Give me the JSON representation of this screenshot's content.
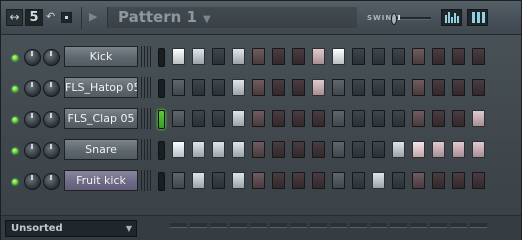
{
  "titlebar": {
    "channel_number": "5",
    "pattern_name": "Pattern 1",
    "swing_label": "SWING",
    "icons": [
      "arrows-icon",
      "undo-icon",
      "menu-icon",
      "play-arrow-icon",
      "dropdown-icon",
      "graph-view-icon",
      "keyboard-view-icon"
    ]
  },
  "swing_level": 0,
  "channels": [
    {
      "name": "Kick",
      "selected": false,
      "active_selector": false
    },
    {
      "name": "FLS_Hatop 05",
      "selected": false,
      "active_selector": false
    },
    {
      "name": "FLS_Clap 05",
      "selected": false,
      "active_selector": true
    },
    {
      "name": "Snare",
      "selected": false,
      "active_selector": false
    },
    {
      "name": "Fruit kick",
      "selected": true,
      "active_selector": false
    }
  ],
  "steps": [
    [
      1,
      1,
      0,
      1,
      0,
      0,
      0,
      1,
      1,
      0,
      0,
      0,
      0,
      0,
      0,
      0
    ],
    [
      0,
      0,
      0,
      1,
      0,
      0,
      0,
      1,
      0,
      0,
      0,
      0,
      0,
      0,
      0,
      0
    ],
    [
      0,
      0,
      0,
      1,
      0,
      0,
      0,
      0,
      0,
      0,
      0,
      0,
      0,
      0,
      0,
      1
    ],
    [
      1,
      1,
      1,
      1,
      0,
      0,
      0,
      0,
      0,
      0,
      0,
      1,
      1,
      1,
      1,
      1
    ],
    [
      0,
      1,
      0,
      1,
      0,
      0,
      0,
      0,
      0,
      0,
      1,
      0,
      0,
      0,
      0,
      0
    ]
  ],
  "filter": {
    "value": "Unsorted"
  },
  "colors": {
    "accent_led": "#5ed33a",
    "selected_channel": "#6f6a86"
  }
}
